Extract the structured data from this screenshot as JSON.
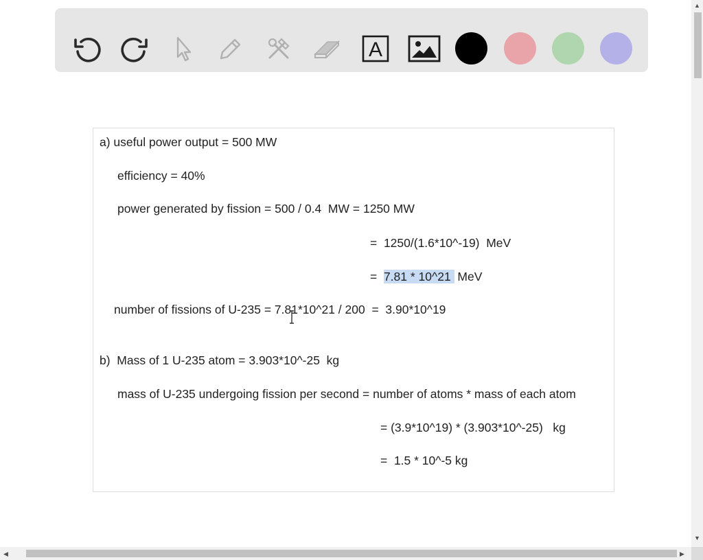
{
  "toolbar": {
    "tools": [
      {
        "name": "undo-icon"
      },
      {
        "name": "redo-icon"
      },
      {
        "name": "pointer-icon"
      },
      {
        "name": "pencil-icon"
      },
      {
        "name": "tools-icon"
      },
      {
        "name": "eraser-icon"
      },
      {
        "name": "text-tool-icon",
        "glyph": "A"
      },
      {
        "name": "image-icon"
      }
    ],
    "colors": [
      {
        "name": "color-black",
        "hex": "#000000"
      },
      {
        "name": "color-red",
        "hex": "#e8a4a8"
      },
      {
        "name": "color-green",
        "hex": "#afd6ae"
      },
      {
        "name": "color-blue",
        "hex": "#b3b1e8"
      }
    ]
  },
  "doc": {
    "a_line1": "a) useful power output = 500 MW",
    "a_line2": "efficiency = 40%",
    "a_line3": "power generated by fission = 500 / 0.4  MW = 1250 MW",
    "a_line4": "=  1250/(1.6*10^-19)  MeV",
    "a_line5_prefix": "=  ",
    "a_line5_highlight": "7.81 * 10^21 ",
    "a_line5_suffix": " MeV",
    "a_line6": "number of fissions of U-235 = 7.81*10^21 / 200  =  3.90*10^19",
    "b_line1": "b)  Mass of 1 U-235 atom = 3.903*10^-25  kg",
    "b_line2": "mass of U-235 undergoing fission per second = number of atoms * mass of each atom",
    "b_line3": "= (3.9*10^19) * (3.903*10^-25)   kg",
    "b_line4": "=  1.5 * 10^-5 kg"
  },
  "scrollbars": {
    "up": "▲",
    "down": "▼",
    "left": "◀",
    "right": "▶"
  }
}
